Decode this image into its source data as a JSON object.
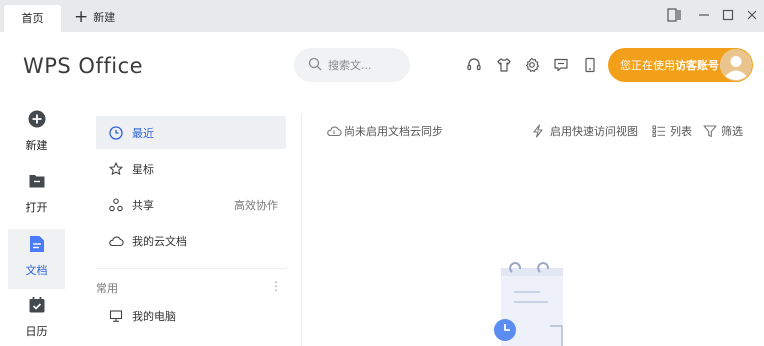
{
  "titlebar": {
    "tabs": [
      {
        "label": "首页"
      }
    ],
    "new_tab_label": "新建"
  },
  "header": {
    "logo": "WPS Office",
    "search_placeholder": "搜索文...",
    "account_prefix": "您正在使用",
    "account_name": "访客账号"
  },
  "leftbar": {
    "items": [
      {
        "label": "新建",
        "icon": "plus-circle-icon"
      },
      {
        "label": "打开",
        "icon": "folder-icon"
      },
      {
        "label": "文档",
        "icon": "document-icon",
        "active": true
      },
      {
        "label": "日历",
        "icon": "calendar-icon"
      }
    ]
  },
  "nav": {
    "items": [
      {
        "label": "最近",
        "icon": "clock-icon",
        "active": true
      },
      {
        "label": "星标",
        "icon": "star-icon"
      },
      {
        "label": "共享",
        "icon": "share-icon",
        "right": "高效协作"
      },
      {
        "label": "我的云文档",
        "icon": "cloud-icon"
      }
    ],
    "section_label": "常用",
    "section_items": [
      {
        "label": "我的电脑",
        "icon": "computer-icon"
      }
    ]
  },
  "toolbar": {
    "cloud_sync": "尚未启用文档云同步",
    "quick_access": "启用快速访问视图",
    "list": "列表",
    "filter": "筛选"
  },
  "colors": {
    "accent": "#f2a019",
    "nav_active": "#eef0f4",
    "icon_blue": "#4a7cf7",
    "titlebar": "#e8e9eb"
  }
}
